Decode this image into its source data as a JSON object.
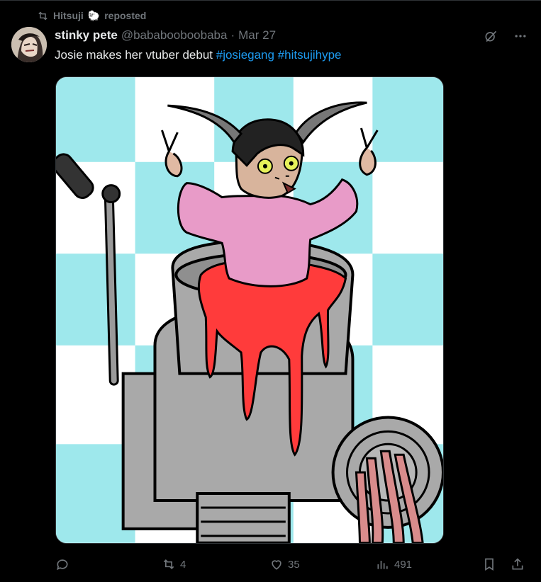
{
  "repost": {
    "reposter_name": "Hitsuji",
    "reposter_emoji": "🐑",
    "label": "reposted",
    "icon": "repost-icon"
  },
  "tweet": {
    "author_name": "stinky pete",
    "author_handle": "@bababooboobaba",
    "separator": "·",
    "date": "Mar 27",
    "text_plain": "Josie makes her vtuber debut ",
    "hashtags": [
      "#josiegang",
      "#hitsujihype"
    ]
  },
  "top_actions": {
    "grok_icon": "grok-icon",
    "more_icon": "more-icon"
  },
  "media": {
    "description_icon": "cartoon-image"
  },
  "actions": {
    "reply": {
      "icon": "reply-icon",
      "count": ""
    },
    "retweet": {
      "icon": "retweet-icon",
      "count": "4"
    },
    "like": {
      "icon": "heart-icon",
      "count": "35"
    },
    "views": {
      "icon": "views-icon",
      "count": "491"
    },
    "bookmark": {
      "icon": "bookmark-icon"
    },
    "share": {
      "icon": "share-icon"
    }
  },
  "colors": {
    "background": "#000000",
    "text": "#e7e9ea",
    "muted": "#71767b",
    "link": "#1d9bf0",
    "border": "#2f3336"
  }
}
